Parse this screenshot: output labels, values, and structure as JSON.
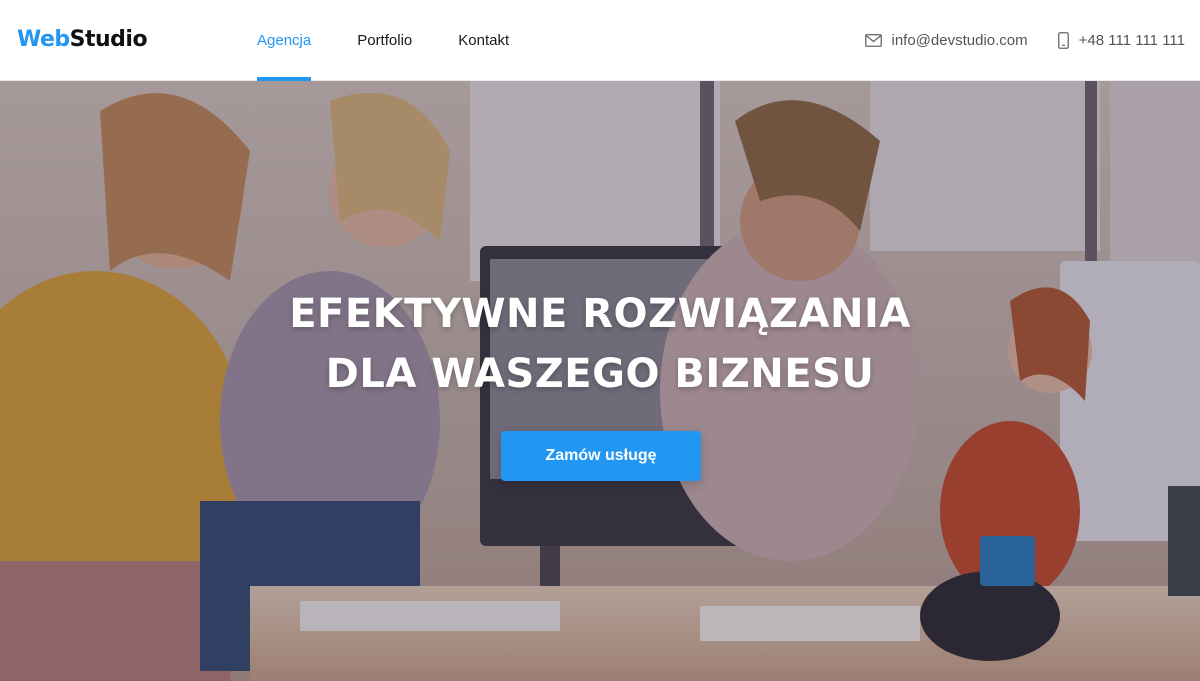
{
  "header": {
    "logo": {
      "accent": "Web",
      "rest": "Studio"
    },
    "nav": [
      {
        "label": "Agencja",
        "active": true
      },
      {
        "label": "Portfolio",
        "active": false
      },
      {
        "label": "Kontakt",
        "active": false
      }
    ],
    "contacts": {
      "email": "info@devstudio.com",
      "phone": "+48 111 111 111"
    }
  },
  "hero": {
    "title_line1": "EFEKTYWNE ROZWIĄZANIA",
    "title_line2": "DLA WASZEGO BIZNESU",
    "cta_label": "Zamów usługę"
  },
  "colors": {
    "accent": "#2196f3",
    "text_dark": "#1a1a1a",
    "text_muted": "#555555"
  },
  "icons": [
    "envelope-icon",
    "phone-icon"
  ]
}
